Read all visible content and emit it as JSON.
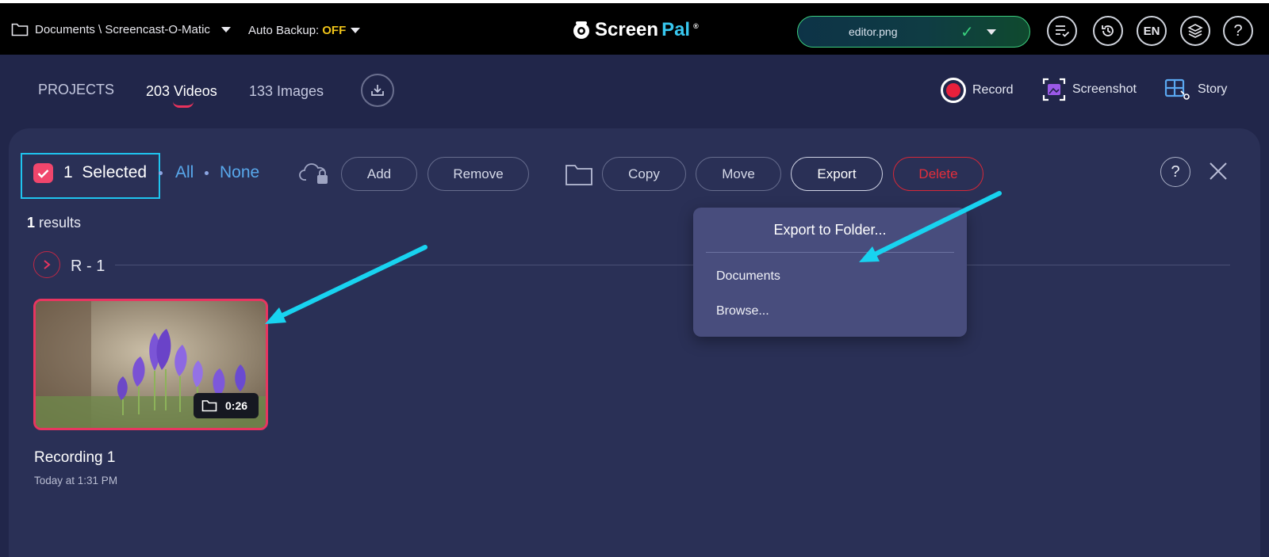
{
  "topbar": {
    "path": "Documents \\ Screencast-O-Matic",
    "backup_label": "Auto Backup:",
    "backup_value": "OFF",
    "logo_screen": "Screen",
    "logo_pal": "Pal",
    "logo_mark": "®",
    "file_name": "editor.png",
    "language": "EN",
    "help": "?"
  },
  "tabs": {
    "projects": "PROJECTS",
    "videos": "203 Videos",
    "images": "133 Images"
  },
  "actions": {
    "record": "Record",
    "screenshot": "Screenshot",
    "story": "Story"
  },
  "selection": {
    "count": "1",
    "selected_label": "Selected",
    "all": "All",
    "none": "None",
    "add": "Add",
    "remove": "Remove",
    "copy": "Copy",
    "move": "Move",
    "export": "Export",
    "delete": "Delete",
    "help": "?"
  },
  "results": {
    "count": "1",
    "label": "results"
  },
  "group": {
    "label": "R - 1"
  },
  "recording": {
    "title": "Recording 1",
    "date": "Today at 1:31 PM",
    "duration": "0:26"
  },
  "export_menu": {
    "title": "Export to Folder...",
    "items": [
      "Documents",
      "Browse..."
    ]
  },
  "colors": {
    "accent_pink": "#e8325c",
    "delete_red": "#e52e3b",
    "link_blue": "#58a8ec",
    "highlight_cyan": "#1fc4ef",
    "backup_off": "#f0c419"
  }
}
